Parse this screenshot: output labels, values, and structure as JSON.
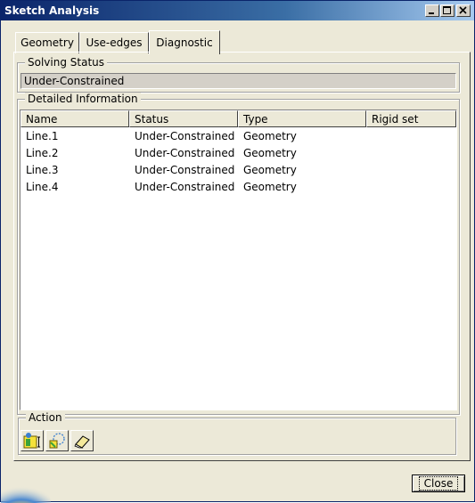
{
  "window": {
    "title": "Sketch Analysis"
  },
  "titlebar_buttons": [
    {
      "name": "minimize-button",
      "icon": "minimize-icon"
    },
    {
      "name": "maximize-button",
      "icon": "maximize-icon"
    },
    {
      "name": "close-window-button",
      "icon": "close-icon"
    }
  ],
  "tabs": [
    {
      "label": "Geometry",
      "active": false
    },
    {
      "label": "Use-edges",
      "active": false
    },
    {
      "label": "Diagnostic",
      "active": true
    }
  ],
  "solving_status": {
    "label": "Solving Status",
    "value": "Under-Constrained"
  },
  "detailed_information": {
    "label": "Detailed Information",
    "columns": [
      "Name",
      "Status",
      "Type",
      "Rigid set"
    ],
    "rows": [
      {
        "name": "Line.1",
        "status": "Under-Constrained",
        "type": "Geometry",
        "rigid_set": ""
      },
      {
        "name": "Line.2",
        "status": "Under-Constrained",
        "type": "Geometry",
        "rigid_set": ""
      },
      {
        "name": "Line.3",
        "status": "Under-Constrained",
        "type": "Geometry",
        "rigid_set": ""
      },
      {
        "name": "Line.4",
        "status": "Under-Constrained",
        "type": "Geometry",
        "rigid_set": ""
      }
    ]
  },
  "action": {
    "label": "Action",
    "buttons": [
      {
        "icon": "show-geometry-icon"
      },
      {
        "icon": "select-constraints-icon"
      },
      {
        "icon": "eraser-icon"
      }
    ]
  },
  "footer": {
    "close_label": "Close"
  },
  "colors": {
    "title_bar_start": "#0a246a",
    "title_bar_end": "#a6caf0",
    "window_bg": "#ece9d8"
  }
}
